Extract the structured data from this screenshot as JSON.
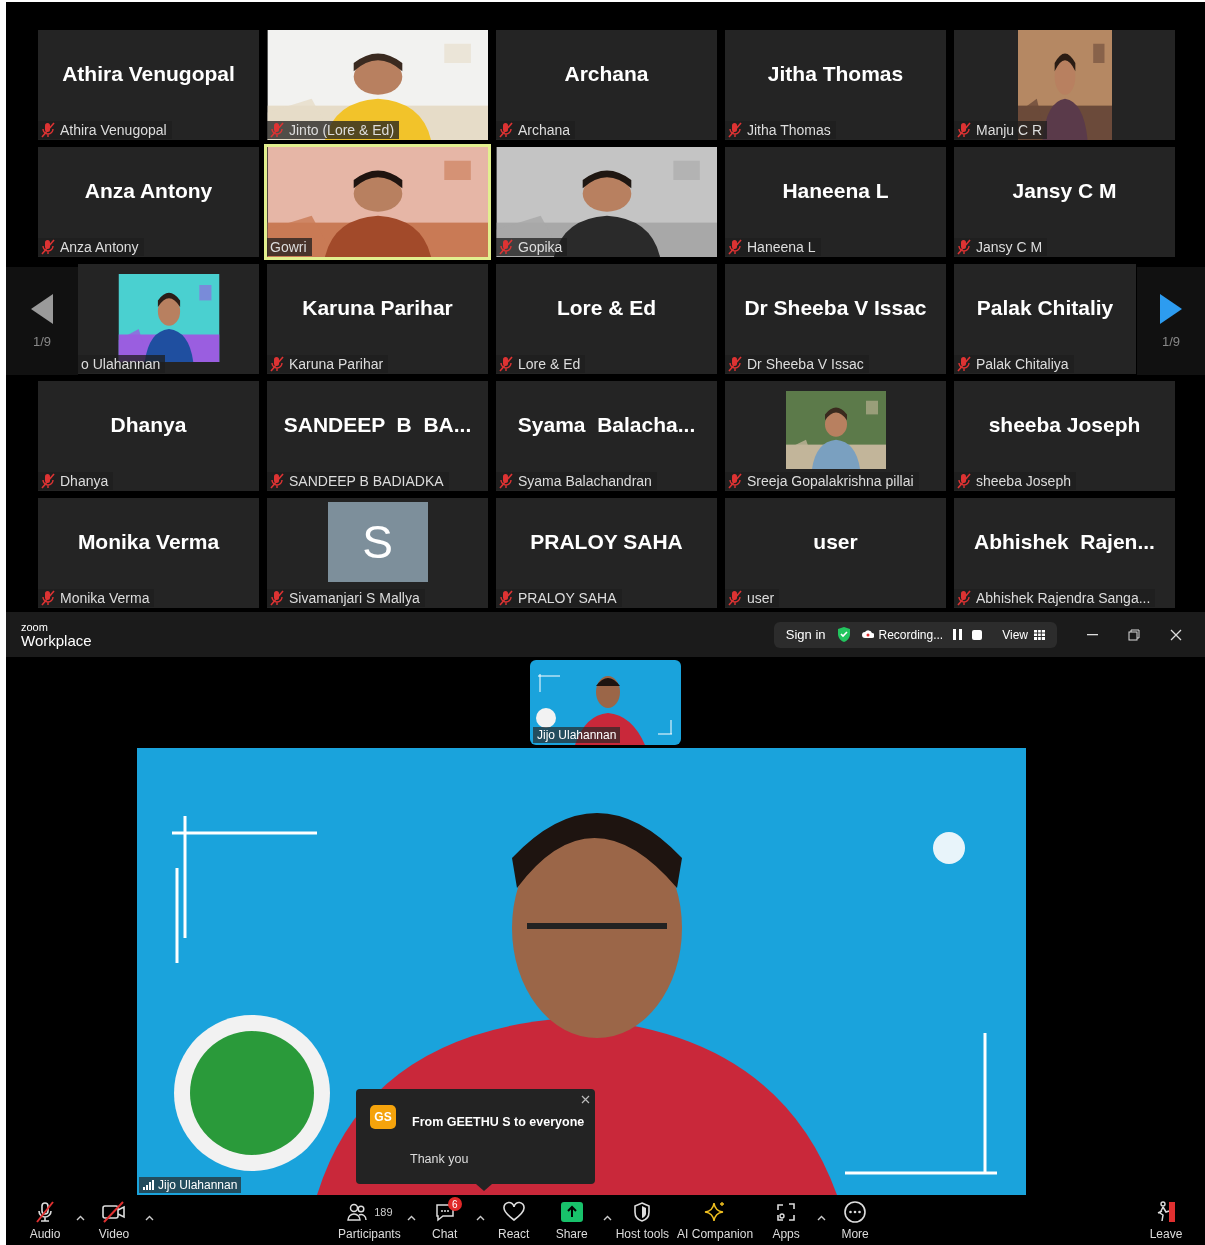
{
  "gallery": {
    "tiles": [
      {
        "kind": "name",
        "display_name": "Athira Venugopal",
        "label": "Athira Venugopal",
        "muted": true,
        "speaking": false
      },
      {
        "kind": "video",
        "label": "Jinto (Lore & Ed)",
        "muted": true,
        "speaking": false
      },
      {
        "kind": "name",
        "display_name": "Archana",
        "label": "Archana",
        "muted": true,
        "speaking": false
      },
      {
        "kind": "name",
        "display_name": "Jitha Thomas",
        "label": "Jitha Thomas",
        "muted": true,
        "speaking": false
      },
      {
        "kind": "video",
        "label": "Manju C R",
        "muted": true,
        "speaking": false
      },
      {
        "kind": "name",
        "display_name": "Anza Antony",
        "label": "Anza Antony",
        "muted": true,
        "speaking": false
      },
      {
        "kind": "video",
        "label": "Gowri",
        "muted": false,
        "speaking": true
      },
      {
        "kind": "video",
        "label": "Gopika",
        "muted": true,
        "speaking": false
      },
      {
        "kind": "name",
        "display_name": "Haneena L",
        "label": "Haneena L",
        "muted": true,
        "speaking": false
      },
      {
        "kind": "name",
        "display_name": "Jansy C M",
        "label": "Jansy C M",
        "muted": true,
        "speaking": false
      },
      {
        "kind": "video",
        "label": "o Ulahannan",
        "muted": false,
        "speaking": false
      },
      {
        "kind": "name",
        "display_name": "Karuna Parihar",
        "label": "Karuna Parihar",
        "muted": true,
        "speaking": false
      },
      {
        "kind": "name",
        "display_name": "Lore & Ed",
        "label": "Lore & Ed",
        "muted": true,
        "speaking": false
      },
      {
        "kind": "name",
        "display_name": "Dr Sheeba V Issac",
        "label": "Dr Sheeba V Issac",
        "muted": true,
        "speaking": false
      },
      {
        "kind": "name",
        "display_name": "Palak Chitaliy",
        "label": "Palak Chitaliya",
        "muted": true,
        "speaking": false
      },
      {
        "kind": "name",
        "display_name": "Dhanya",
        "label": "Dhanya",
        "muted": true,
        "speaking": false
      },
      {
        "kind": "name",
        "display_name": "SANDEEP  B  BA...",
        "label": "SANDEEP B BADIADKA",
        "muted": true,
        "speaking": false
      },
      {
        "kind": "name",
        "display_name": "Syama  Balacha...",
        "label": "Syama Balachandran",
        "muted": true,
        "speaking": false
      },
      {
        "kind": "video",
        "label": "Sreeja Gopalakrishna pillai",
        "muted": true,
        "speaking": false
      },
      {
        "kind": "name",
        "display_name": "sheeba Joseph",
        "label": "sheeba Joseph",
        "muted": true,
        "speaking": false
      },
      {
        "kind": "name",
        "display_name": "Monika Verma",
        "label": "Monika Verma",
        "muted": true,
        "speaking": false
      },
      {
        "kind": "letter",
        "letter": "S",
        "label": "Sivamanjari S Mallya",
        "muted": true,
        "speaking": false
      },
      {
        "kind": "name",
        "display_name": "PRALOY SAHA",
        "label": "PRALOY SAHA",
        "muted": true,
        "speaking": false
      },
      {
        "kind": "name",
        "display_name": "user",
        "label": "user",
        "muted": true,
        "speaking": false
      },
      {
        "kind": "name",
        "display_name": "Abhishek  Rajen...",
        "label": "Abhishek Rajendra Sanga...",
        "muted": true,
        "speaking": false
      }
    ],
    "pager": [
      {
        "page": "1/9",
        "enabled": false
      },
      {
        "page": "1/9",
        "enabled": true
      }
    ]
  },
  "title_bar": {
    "brand_small": "zoom",
    "brand": "Workplace",
    "sign_in": "Sign in",
    "recording": "Recording...",
    "view": "View"
  },
  "stage": {
    "thumbnail": {
      "name": "Jijo Ulahannan"
    },
    "main": {
      "name": "Jijo Ulahannan"
    },
    "chat_popup": {
      "initials": "GS",
      "sender": "From GEETHU S to everyone",
      "message": "Thank you"
    }
  },
  "toolbar": [
    {
      "label": "Audio",
      "off": true,
      "menu": true
    },
    {
      "label": "Video",
      "off": true,
      "menu": true
    },
    {
      "label": "Participants",
      "count": "189",
      "menu": true
    },
    {
      "label": "Chat",
      "badge": "6",
      "menu": true
    },
    {
      "label": "React"
    },
    {
      "label": "Share",
      "menu": true
    },
    {
      "label": "Host tools"
    },
    {
      "label": "AI Companion"
    },
    {
      "label": "Apps",
      "menu": true
    },
    {
      "label": "More"
    },
    {
      "label": "Leave"
    }
  ]
}
